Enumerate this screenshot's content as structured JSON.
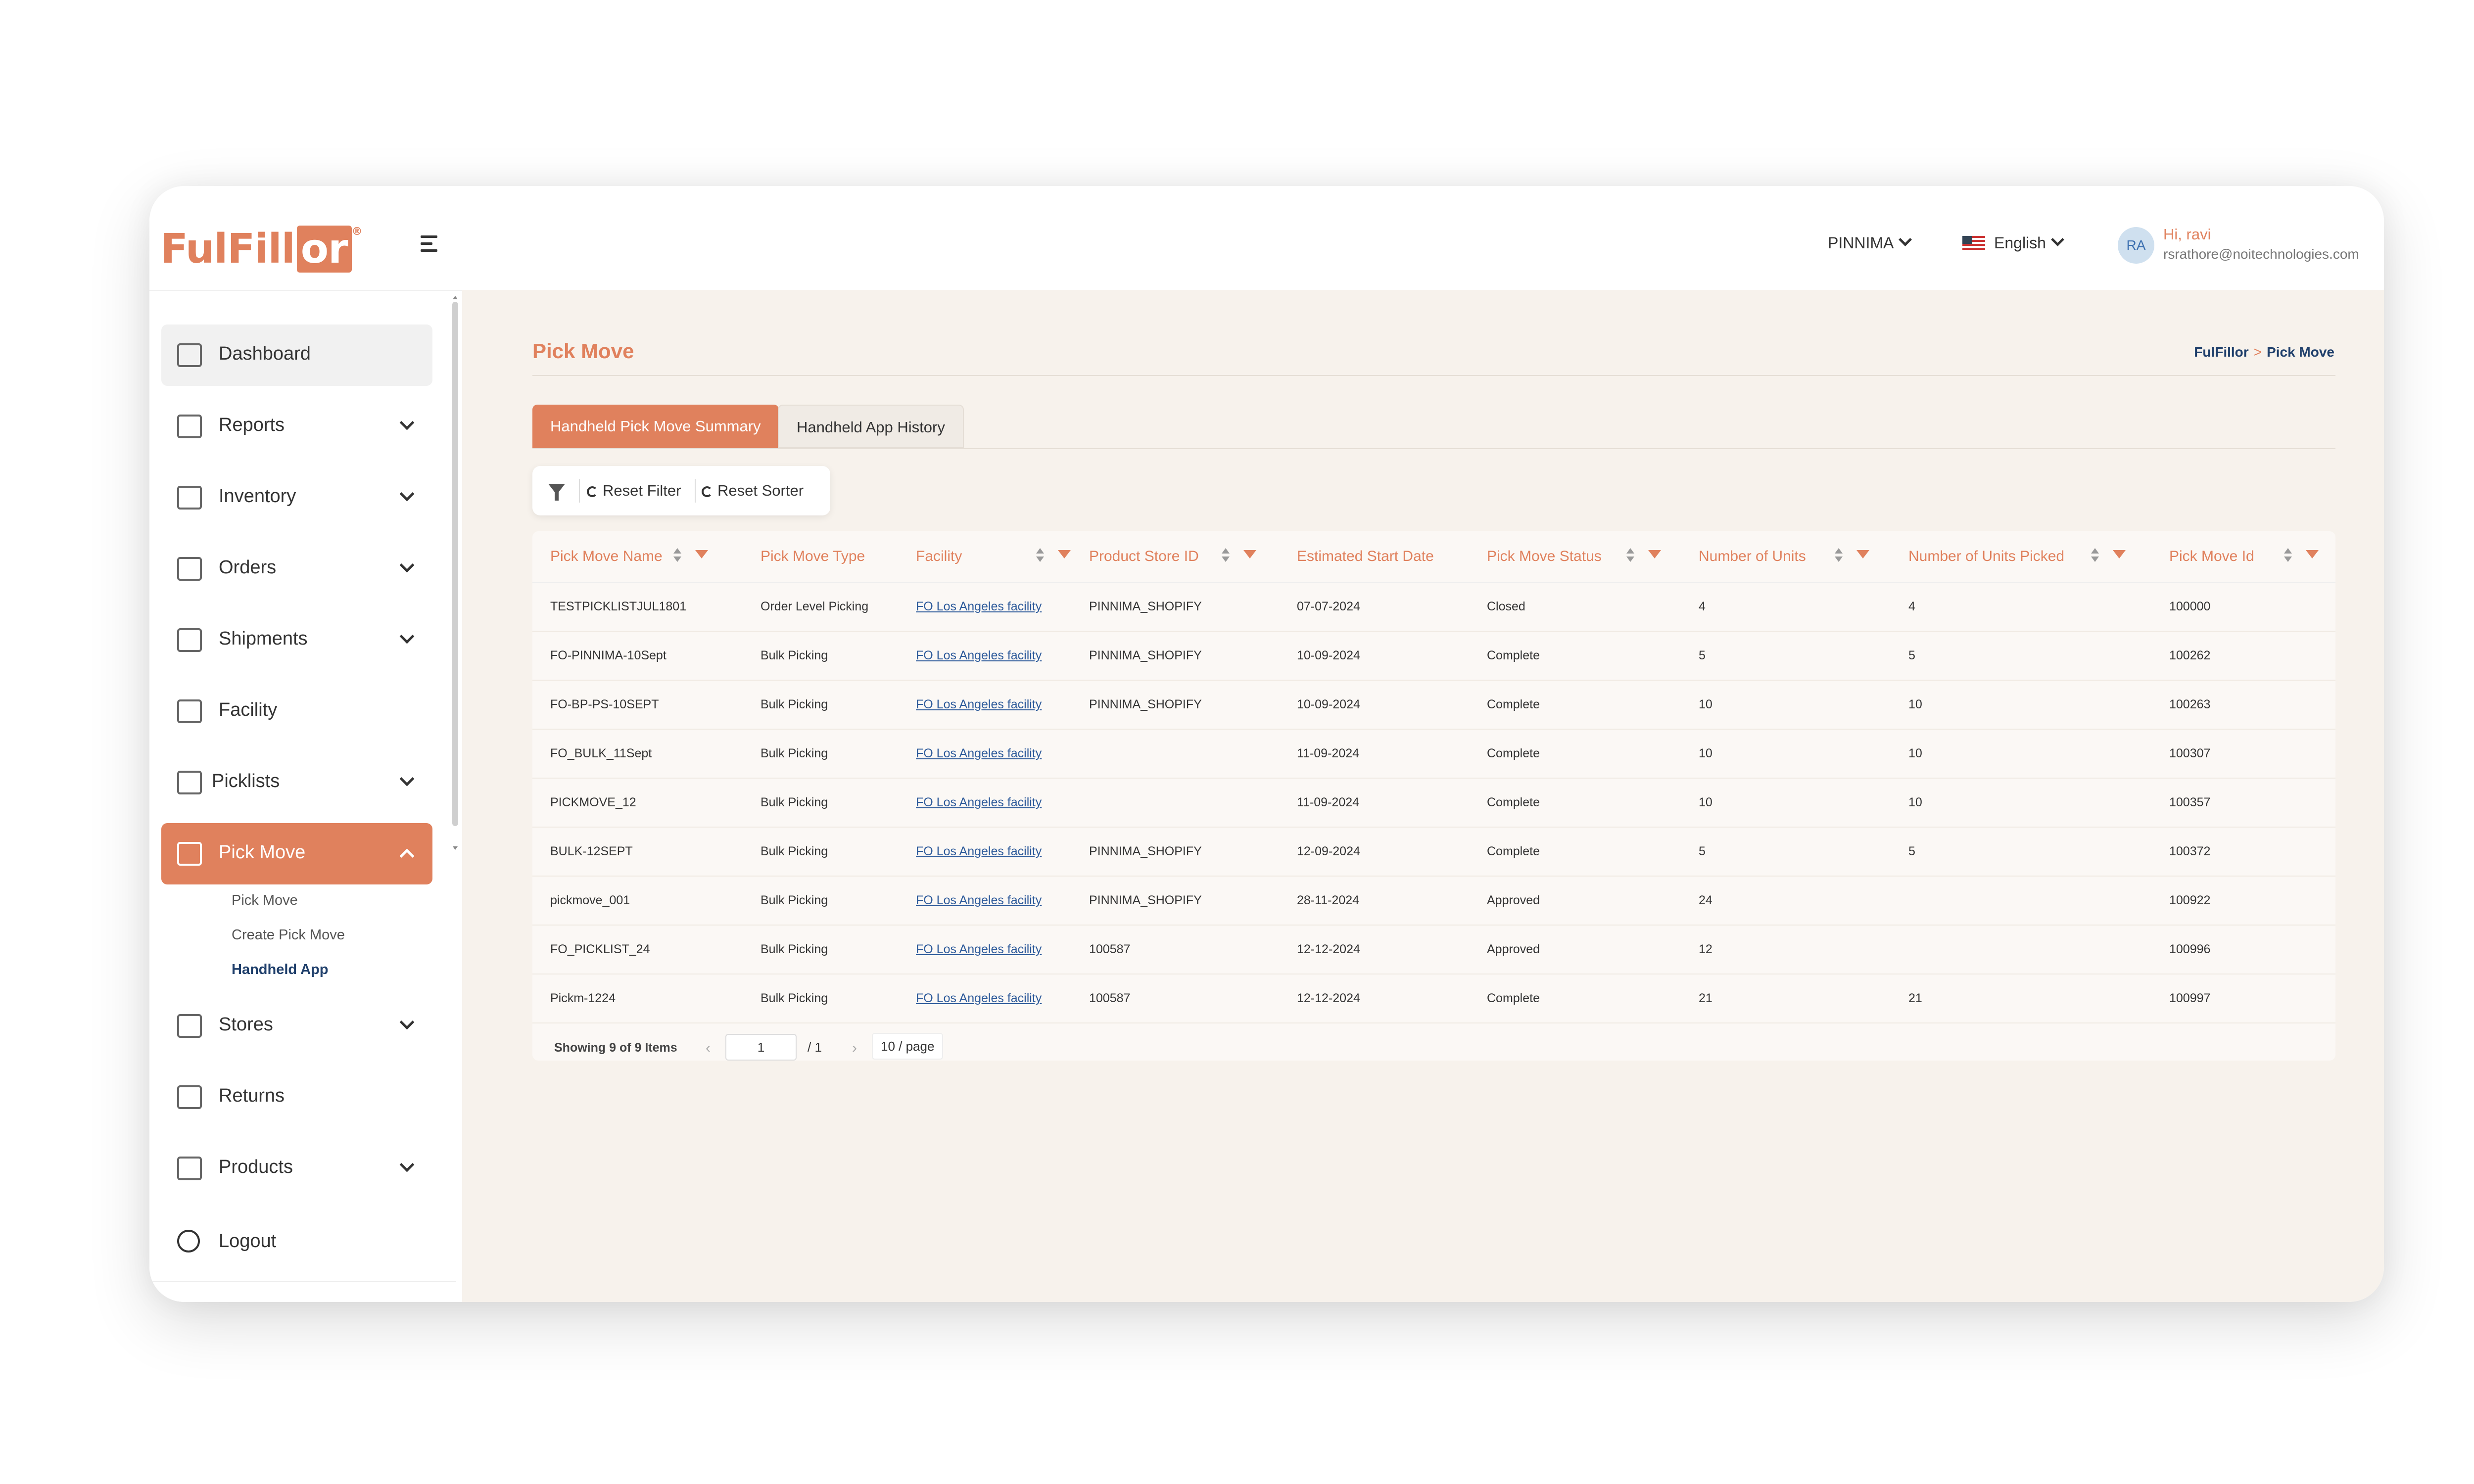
{
  "brand": {
    "name": "FulFill",
    "suffix": "or",
    "reg": "®"
  },
  "header": {
    "store": "PINNIMA",
    "language": "English",
    "avatar_initials": "RA",
    "greeting": "Hi, ravi",
    "email": "rsrathore@noitechnologies.com"
  },
  "sidebar": {
    "items": [
      {
        "label": "Dashboard",
        "icon": "dashboard-icon"
      },
      {
        "label": "Reports",
        "icon": "reports-icon"
      },
      {
        "label": "Inventory",
        "icon": "inventory-icon"
      },
      {
        "label": "Orders",
        "icon": "orders-icon"
      },
      {
        "label": "Shipments",
        "icon": "shipments-icon"
      },
      {
        "label": "Facility",
        "icon": "facility-icon"
      },
      {
        "label": "Picklists",
        "icon": "picklists-icon"
      },
      {
        "label": "Pick Move",
        "icon": "pick-move-icon"
      },
      {
        "label": "Stores",
        "icon": "stores-icon"
      },
      {
        "label": "Returns",
        "icon": "returns-icon"
      },
      {
        "label": "Products",
        "icon": "products-icon"
      }
    ],
    "sub_items": [
      "Pick Move",
      "Create Pick Move",
      "Handheld App"
    ],
    "logout": "Logout"
  },
  "page": {
    "title": "Pick Move",
    "breadcrumb": [
      "FulFillor",
      "Pick Move"
    ],
    "tabs": [
      "Handheld Pick Move Summary",
      "Handheld App History"
    ],
    "toolbar": {
      "reset_filter": "Reset Filter",
      "reset_sorter": "Reset Sorter"
    }
  },
  "table": {
    "columns": [
      "Pick Move Name",
      "Pick Move Type",
      "Facility",
      "Product Store ID",
      "Estimated Start Date",
      "Pick Move Status",
      "Number of Units",
      "Number of Units Picked",
      "Pick Move Id"
    ],
    "rows": [
      [
        "TESTPICKLISTJUL1801",
        "Order Level Picking",
        "FO Los Angeles facility",
        "PINNIMA_SHOPIFY",
        "07-07-2024",
        "Closed",
        "4",
        "4",
        "100000"
      ],
      [
        "FO-PINNIMA-10Sept",
        "Bulk Picking",
        "FO Los Angeles facility",
        "PINNIMA_SHOPIFY",
        "10-09-2024",
        "Complete",
        "5",
        "5",
        "100262"
      ],
      [
        "FO-BP-PS-10SEPT",
        "Bulk Picking",
        "FO Los Angeles facility",
        "PINNIMA_SHOPIFY",
        "10-09-2024",
        "Complete",
        "10",
        "10",
        "100263"
      ],
      [
        "FO_BULK_11Sept",
        "Bulk Picking",
        "FO Los Angeles facility",
        "",
        "11-09-2024",
        "Complete",
        "10",
        "10",
        "100307"
      ],
      [
        "PICKMOVE_12",
        "Bulk Picking",
        "FO Los Angeles facility",
        "",
        "11-09-2024",
        "Complete",
        "10",
        "10",
        "100357"
      ],
      [
        "BULK-12SEPT",
        "Bulk Picking",
        "FO Los Angeles facility",
        "PINNIMA_SHOPIFY",
        "12-09-2024",
        "Complete",
        "5",
        "5",
        "100372"
      ],
      [
        "pickmove_001",
        "Bulk Picking",
        "FO Los Angeles facility",
        "PINNIMA_SHOPIFY",
        "28-11-2024",
        "Approved",
        "24",
        "",
        "100922"
      ],
      [
        "FO_PICKLIST_24",
        "Bulk Picking",
        "FO Los Angeles facility",
        "100587",
        "12-12-2024",
        "Approved",
        "12",
        "",
        "100996"
      ],
      [
        "Pickm-1224",
        "Bulk Picking",
        "FO Los Angeles facility",
        "100587",
        "12-12-2024",
        "Complete",
        "21",
        "21",
        "100997"
      ]
    ]
  },
  "pagination": {
    "info": "Showing 9 of 9 Items",
    "current_page": "1",
    "total_pages": "/ 1",
    "page_size": "10 / page"
  },
  "colors": {
    "accent": "#e0815d",
    "link": "#2d5a9a",
    "background": "#f7f2ec"
  }
}
